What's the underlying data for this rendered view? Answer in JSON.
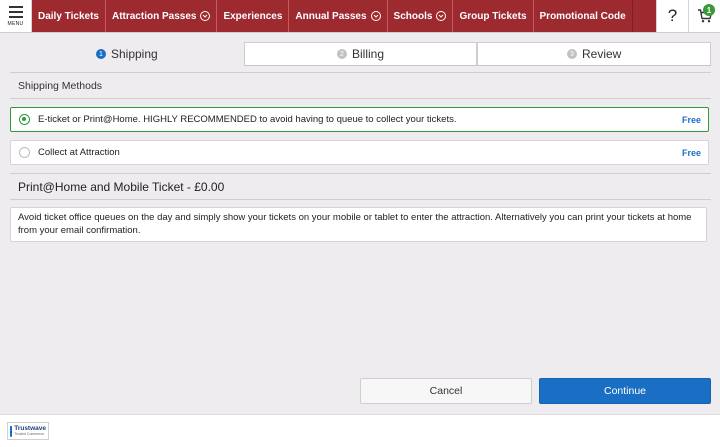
{
  "header": {
    "menu_label": "MENU",
    "nav": [
      {
        "label": "Daily Tickets",
        "dropdown": false
      },
      {
        "label": "Attraction Passes",
        "dropdown": true
      },
      {
        "label": "Experiences",
        "dropdown": false
      },
      {
        "label": "Annual Passes",
        "dropdown": true
      },
      {
        "label": "Schools",
        "dropdown": true
      },
      {
        "label": "Group Tickets",
        "dropdown": false
      },
      {
        "label": "Promotional Code",
        "dropdown": false
      }
    ],
    "help_label": "?",
    "cart_count": "1",
    "brand_color": "#9c2a2f"
  },
  "steps": [
    {
      "number": "1",
      "label": "Shipping",
      "active": true
    },
    {
      "number": "2",
      "label": "Billing",
      "active": false
    },
    {
      "number": "3",
      "label": "Review",
      "active": false
    }
  ],
  "shipping": {
    "section_title": "Shipping Methods",
    "options": [
      {
        "label": "E-ticket or Print@Home. HIGHLY RECOMMENDED to avoid having to queue to collect your tickets.",
        "price": "Free",
        "selected": true
      },
      {
        "label": "Collect at Attraction",
        "price": "Free",
        "selected": false
      }
    ],
    "ticket_title": "Print@Home and Mobile Ticket - £0.00",
    "description": "Avoid ticket office queues on the day and simply show your tickets on your mobile or tablet to enter the attraction. Alternatively you can print your tickets at home from your email confirmation."
  },
  "actions": {
    "cancel_label": "Cancel",
    "continue_label": "Continue",
    "accent_color": "#1a6fc4"
  },
  "footer": {
    "trust_brand": "Trustwave",
    "trust_sub": "Trusted Commerce"
  }
}
